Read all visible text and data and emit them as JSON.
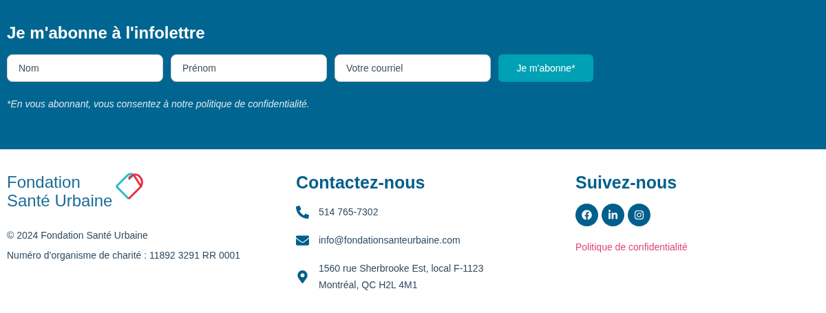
{
  "newsletter": {
    "title": "Je m'abonne à l'infolettre",
    "fields": [
      {
        "placeholder": "Nom"
      },
      {
        "placeholder": "Prénom"
      },
      {
        "placeholder": "Votre courriel"
      }
    ],
    "button": "Je m'abonne*",
    "note": "*En vous abonnant, vous consentez à notre politique de confidentialité."
  },
  "footer": {
    "logo": {
      "line1": "Fondation",
      "line2": "Santé Urbaine"
    },
    "copyright": "© 2024 Fondation Santé Urbaine",
    "charity": "Numéro d’organisme de charité : 11892 3291 RR 0001",
    "contact": {
      "title": "Contactez-nous",
      "items": [
        {
          "kind": "phone",
          "lines": [
            "514 765-7302"
          ]
        },
        {
          "kind": "email",
          "lines": [
            "info@fondationsanteurbaine.com"
          ]
        },
        {
          "kind": "address",
          "lines": [
            "1560 rue Sherbrooke Est, local F-1123",
            "Montréal, QC H2L 4M1"
          ]
        }
      ]
    },
    "follow": {
      "title": "Suivez-nous",
      "socials": [
        {
          "kind": "facebook"
        },
        {
          "kind": "linkedin"
        },
        {
          "kind": "instagram"
        }
      ],
      "link": "Politique de confidentialité"
    }
  }
}
